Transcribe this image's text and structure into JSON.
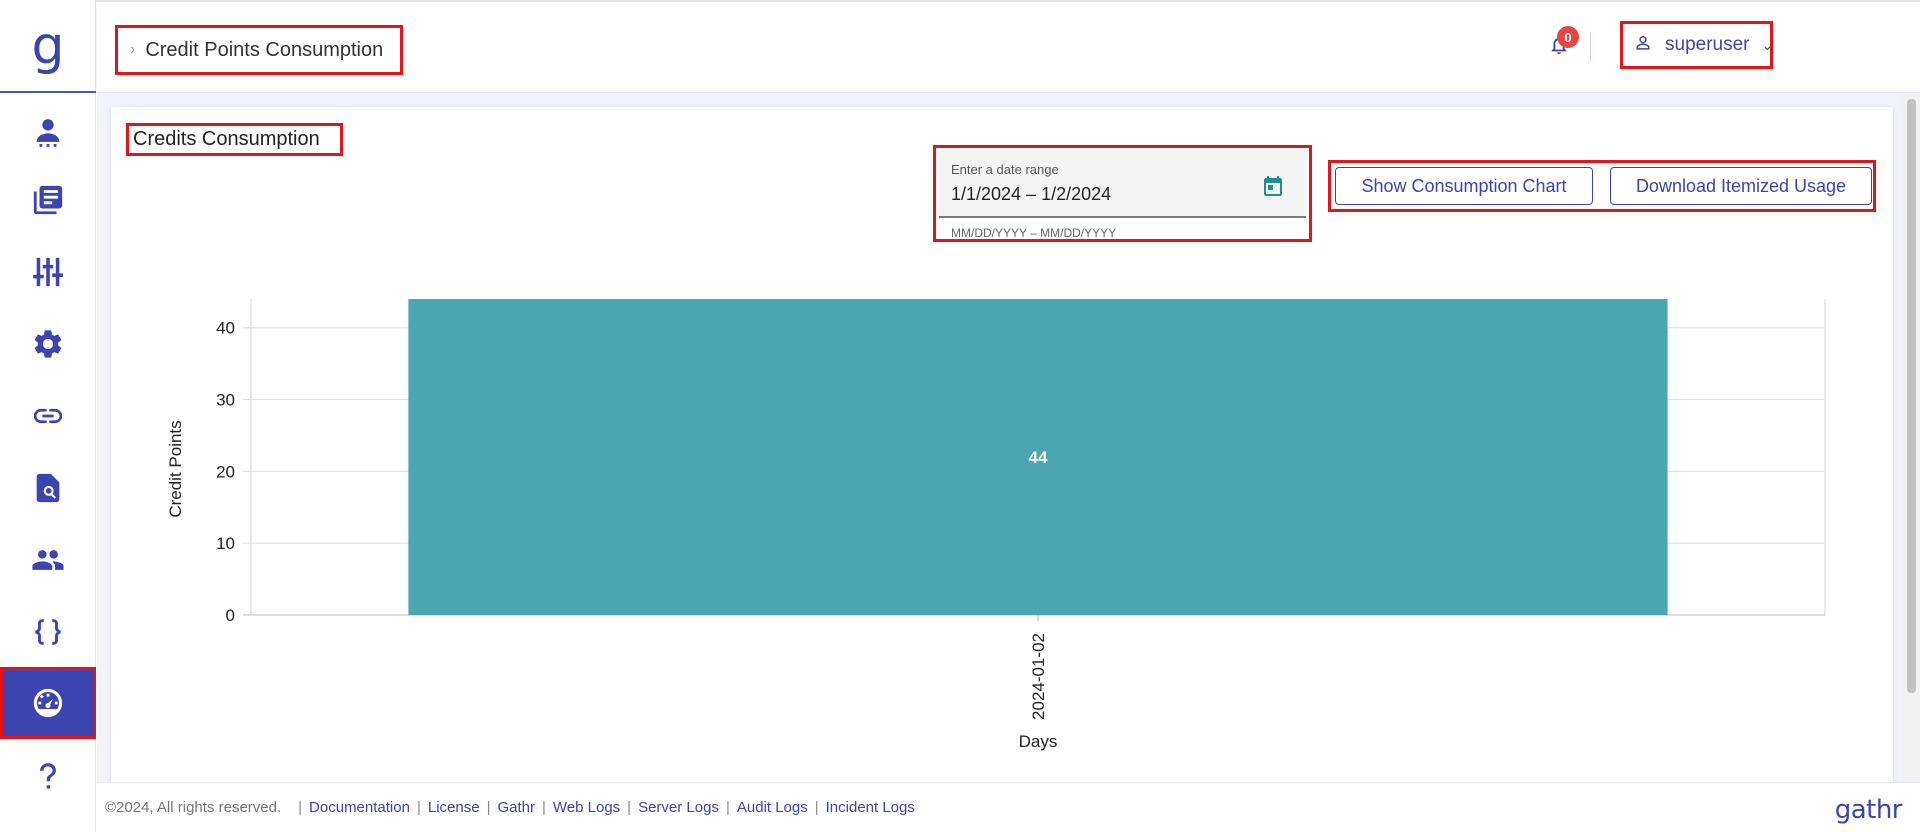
{
  "app": {
    "logo_glyph": "g",
    "brand": "gathr",
    "accent_color": "#3b44b0",
    "highlight_color": "#e0161b"
  },
  "sidebar": {
    "items": [
      {
        "icon": "user-icon",
        "active": false
      },
      {
        "icon": "document-list-icon",
        "active": false
      },
      {
        "icon": "sliders-icon",
        "active": false
      },
      {
        "icon": "gear-icon",
        "active": false
      },
      {
        "icon": "link-icon",
        "active": false
      },
      {
        "icon": "file-search-icon",
        "active": false
      },
      {
        "icon": "group-icon",
        "active": false
      },
      {
        "icon": "braces-icon",
        "active": false
      },
      {
        "icon": "dashboard-gauge-icon",
        "active": true
      },
      {
        "icon": "help-icon",
        "active": false
      }
    ]
  },
  "header": {
    "breadcrumb_title": "Credit Points Consumption",
    "notification_count": "0",
    "user_name": "superuser"
  },
  "main": {
    "card_title": "Credits Consumption",
    "date_range": {
      "label": "Enter a date range",
      "value": "1/1/2024 – 1/2/2024",
      "hint": "MM/DD/YYYY – MM/DD/YYYY"
    },
    "buttons": {
      "show_chart": "Show Consumption Chart",
      "download": "Download Itemized Usage"
    }
  },
  "chart_data": {
    "type": "bar",
    "categories": [
      "2024-01-02"
    ],
    "values": [
      44
    ],
    "data_labels": [
      "44"
    ],
    "title": "",
    "xlabel": "Days",
    "ylabel": "Credit Points",
    "ylim": [
      0,
      44
    ],
    "yticks": [
      0,
      10,
      20,
      30,
      40
    ],
    "grid": true,
    "bar_color": "#4ca6b0"
  },
  "footer": {
    "copyright": "©2024, All rights reserved.",
    "links": [
      "Documentation",
      "License",
      "Gathr",
      "Web Logs",
      "Server Logs",
      "Audit Logs",
      "Incident Logs"
    ],
    "brand": "gathr"
  }
}
